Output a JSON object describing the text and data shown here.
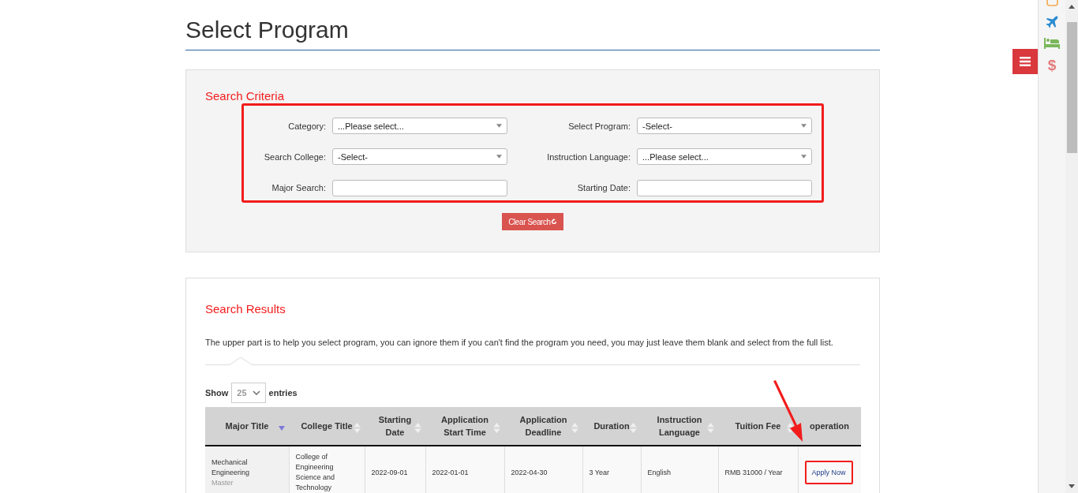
{
  "page_title": "Select Program",
  "criteria": {
    "heading": "Search Criteria",
    "highlighted": true,
    "fields": [
      {
        "label": "Category:",
        "kind": "select",
        "value": "...Please select..."
      },
      {
        "label": "Select Program:",
        "kind": "select",
        "value": "-Select-"
      },
      {
        "label": "Search College:",
        "kind": "select",
        "value": "-Select-"
      },
      {
        "label": "Instruction Language:",
        "kind": "select",
        "value": "...Please select..."
      },
      {
        "label": "Major Search:",
        "kind": "text"
      },
      {
        "label": "Starting Date:",
        "kind": "text"
      }
    ],
    "clear_button": "Clear Search"
  },
  "results": {
    "heading": "Search Results",
    "note": "The upper part is to help you select program, you can ignore them if you can't find the program you need, you may just leave them blank and select from the full list.",
    "show_label": "Show",
    "page_size": "25",
    "entries_label": "entries",
    "columns": [
      {
        "label": "Major Title",
        "sortable": true,
        "sorted": true
      },
      {
        "label": "College Title",
        "sortable": true,
        "sorted": false
      },
      {
        "label": "Starting Date",
        "sortable": true,
        "sorted": false
      },
      {
        "label": "Application Start Time",
        "sortable": true,
        "sorted": false
      },
      {
        "label": "Application Deadline",
        "sortable": true,
        "sorted": false
      },
      {
        "label": "Duration",
        "sortable": true,
        "sorted": false
      },
      {
        "label": "Instruction Language",
        "sortable": true,
        "sorted": false
      },
      {
        "label": "Tuition Fee",
        "sortable": true,
        "sorted": false
      },
      {
        "label": "operation",
        "sortable": false,
        "sorted": false
      }
    ],
    "rows": [
      {
        "major": "Mechanical Engineering",
        "degree": "Master",
        "college": "College of Engineering Science and Technology",
        "start": "2022-09-01",
        "app_start": "2022-01-01",
        "deadline": "2022-04-30",
        "duration": "3 Year",
        "language": "English",
        "fee": "RMB 31000 / Year",
        "action": "Apply Now",
        "highlighted": true
      }
    ]
  },
  "side_toolbar": {
    "dollar": "$"
  }
}
